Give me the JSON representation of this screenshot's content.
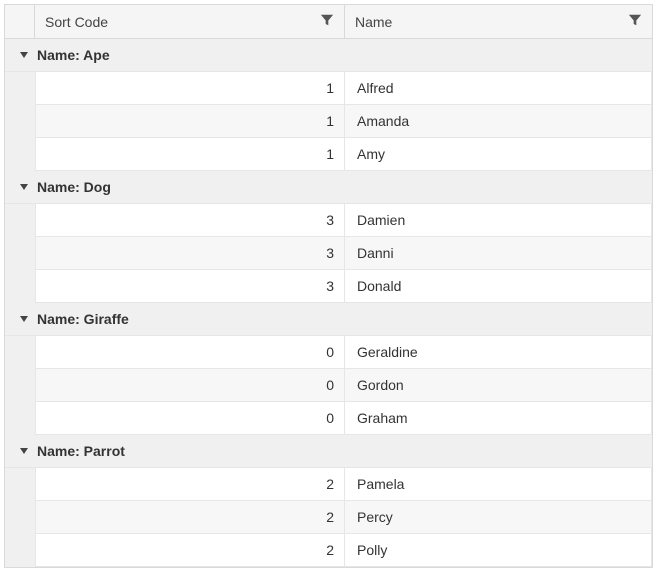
{
  "columns": {
    "sortcode": "Sort Code",
    "name": "Name"
  },
  "groupPrefix": "Name: ",
  "groups": [
    {
      "title": "Ape",
      "rows": [
        {
          "sortcode": "1",
          "name": "Alfred"
        },
        {
          "sortcode": "1",
          "name": "Amanda"
        },
        {
          "sortcode": "1",
          "name": "Amy"
        }
      ]
    },
    {
      "title": "Dog",
      "rows": [
        {
          "sortcode": "3",
          "name": "Damien"
        },
        {
          "sortcode": "3",
          "name": "Danni"
        },
        {
          "sortcode": "3",
          "name": "Donald"
        }
      ]
    },
    {
      "title": "Giraffe",
      "rows": [
        {
          "sortcode": "0",
          "name": "Geraldine"
        },
        {
          "sortcode": "0",
          "name": "Gordon"
        },
        {
          "sortcode": "0",
          "name": "Graham"
        }
      ]
    },
    {
      "title": "Parrot",
      "rows": [
        {
          "sortcode": "2",
          "name": "Pamela"
        },
        {
          "sortcode": "2",
          "name": "Percy"
        },
        {
          "sortcode": "2",
          "name": "Polly"
        }
      ]
    }
  ]
}
